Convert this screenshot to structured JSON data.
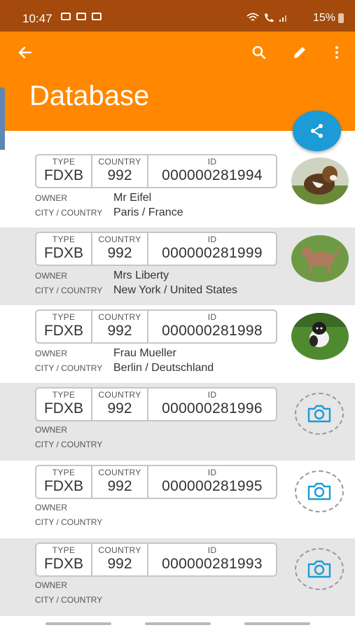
{
  "status_bar": {
    "time": "10:47",
    "battery": "15%"
  },
  "app_bar": {
    "title": "Database"
  },
  "labels": {
    "type": "TYPE",
    "country": "COUNTRY",
    "id": "ID",
    "owner": "OWNER",
    "city_country": "CITY / COUNTRY"
  },
  "records": [
    {
      "type": "FDXB",
      "country": "992",
      "id": "000000281994",
      "owner": "Mr Eifel",
      "city_country": "Paris / France",
      "photo": "dog-photo"
    },
    {
      "type": "FDXB",
      "country": "992",
      "id": "000000281999",
      "owner": "Mrs Liberty",
      "city_country": "New York / United States",
      "photo": "dog-photo"
    },
    {
      "type": "FDXB",
      "country": "992",
      "id": "000000281998",
      "owner": "Frau Mueller",
      "city_country": "Berlin / Deutschland",
      "photo": "dog-photo"
    },
    {
      "type": "FDXB",
      "country": "992",
      "id": "000000281996",
      "owner": "",
      "city_country": "",
      "photo": "camera-icon"
    },
    {
      "type": "FDXB",
      "country": "992",
      "id": "000000281995",
      "owner": "",
      "city_country": "",
      "photo": "camera-icon"
    },
    {
      "type": "FDXB",
      "country": "992",
      "id": "000000281993",
      "owner": "",
      "city_country": "",
      "photo": "camera-icon"
    }
  ],
  "colors": {
    "status_bar": "#a34a0c",
    "app_bar": "#ff8800",
    "fab": "#1c9bd7",
    "row_alt": "#e6e6e6"
  }
}
